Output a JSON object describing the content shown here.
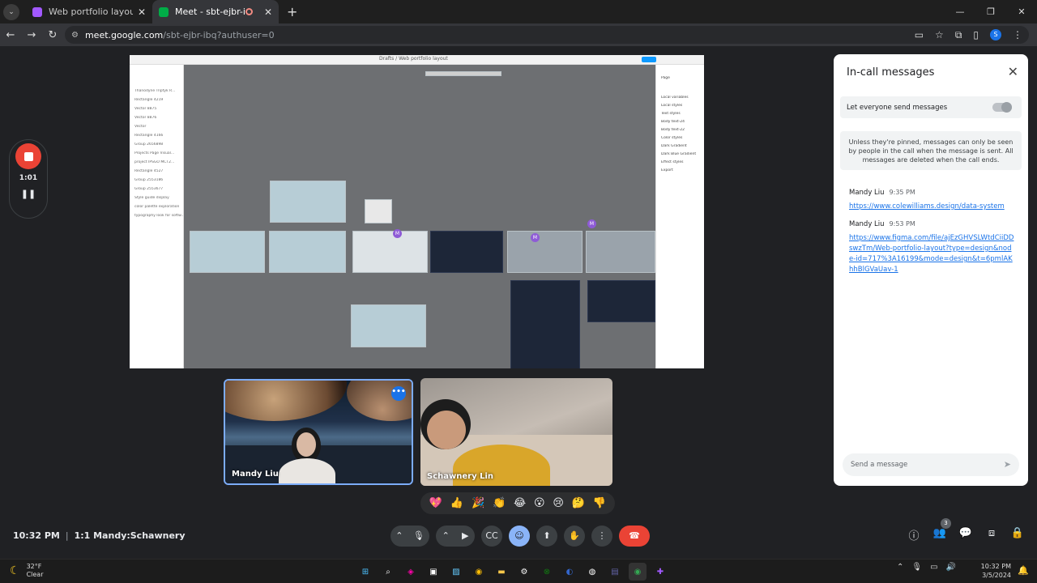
{
  "browser": {
    "tabs": [
      {
        "title": "Web portfolio layout – Figma",
        "favicon_color": "#a259ff"
      },
      {
        "title": "Meet - sbt-ejbr-ibq",
        "favicon_color": "#00ac47"
      }
    ],
    "url_host": "meet.google.com",
    "url_path": "/sbt-ejbr-ibq?authuser=0",
    "profile_initial": "S"
  },
  "figma": {
    "file_title": "Drafts / Web portfolio layout",
    "layers": [
      "Thanodyne Triptyk R...",
      "Rectangle 4219",
      "Vector 8875",
      "Vector 8876",
      "Vector",
      "Rectangle 4166",
      "Group 2656898",
      "Projects Page Visual...",
      "project IPSGO MCT2...",
      "Rectangle 4527",
      "Group 2553186",
      "Group 2553677",
      "Style guide display",
      "color palette exploration",
      "typography look for softw..."
    ],
    "right_panel": [
      "Page",
      "Local variables",
      "Local styles",
      "Text styles",
      "Body text-24",
      "Body text-22",
      "Color styles",
      "Dark Gradient",
      "Dark Blue Gradient",
      "Effect styles",
      "Export"
    ]
  },
  "recording": {
    "time": "1:01"
  },
  "participants": [
    {
      "name": "Mandy Liu"
    },
    {
      "name": "Schawnery Lin"
    }
  ],
  "panel": {
    "title": "In-call messages",
    "toggle_label": "Let everyone send messages",
    "notice": "Unless they're pinned, messages can only be seen by people in the call when the message is sent. All messages are deleted when the call ends.",
    "messages": [
      {
        "sender": "Mandy Liu",
        "time": "9:35 PM",
        "link": "https://www.colewilliams.design/data-system"
      },
      {
        "sender": "Mandy Liu",
        "time": "9:53 PM",
        "link": "https://www.figma.com/file/ajEzGHVSLWtdCiiDDswzTm/Web-portfolio-layout?type=design&node-id=717%3A16199&mode=design&t=6pmlAKhhBlGVaUav-1"
      }
    ],
    "input_placeholder": "Send a message"
  },
  "reactions": [
    "💖",
    "👍",
    "🎉",
    "👏",
    "😂",
    "😮",
    "😢",
    "🤔",
    "👎"
  ],
  "bottom_bar": {
    "time": "10:32 PM",
    "meeting_name": "1:1 Mandy:Schawnery",
    "people_count": "3"
  },
  "taskbar": {
    "temperature": "32°F",
    "condition": "Clear",
    "clock_time": "10:32 PM",
    "clock_date": "3/5/2024"
  },
  "colors": {
    "accent": "#1a73e8",
    "end_call": "#ea4335",
    "active_tile_border": "#7cacf8"
  }
}
